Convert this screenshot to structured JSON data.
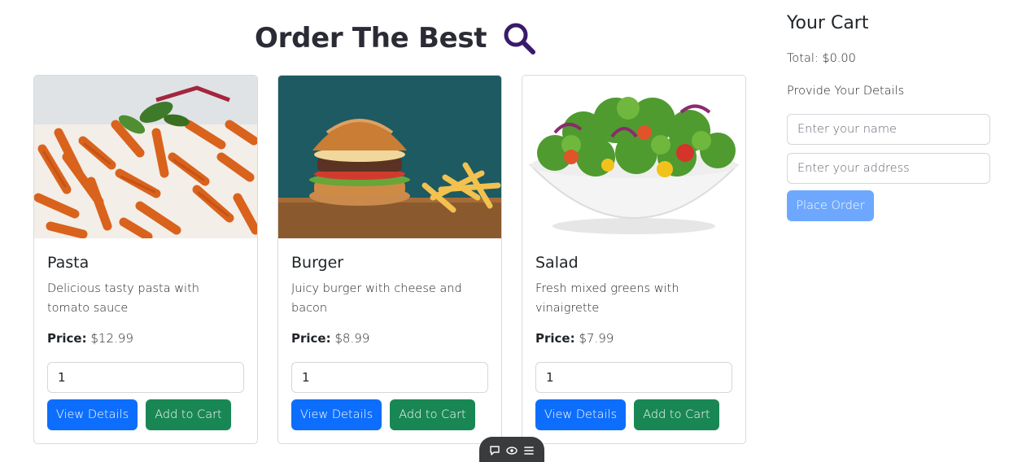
{
  "header": {
    "title": "Order The Best",
    "search_icon": "search-icon"
  },
  "products": [
    {
      "name": "Pasta",
      "description": "Delicious tasty pasta with tomato sauce",
      "price_label": "Price:",
      "price": "$12.99",
      "quantity": "1",
      "details_label": "View Details",
      "cart_label": "Add to Cart"
    },
    {
      "name": "Burger",
      "description": "Juicy burger with cheese and bacon",
      "price_label": "Price:",
      "price": "$8.99",
      "quantity": "1",
      "details_label": "View Details",
      "cart_label": "Add to Cart"
    },
    {
      "name": "Salad",
      "description": "Fresh mixed greens with vinaigrette",
      "price_label": "Price:",
      "price": "$7.99",
      "quantity": "1",
      "details_label": "View Details",
      "cart_label": "Add to Cart"
    }
  ],
  "cart": {
    "title": "Your Cart",
    "total": "Total: $0.00",
    "details_label": "Provide Your Details",
    "name_placeholder": "Enter your name",
    "address_placeholder": "Enter your address",
    "place_order_label": "Place Order"
  },
  "toolbar": {
    "icons": [
      "comment-icon",
      "eye-icon",
      "menu-icon"
    ]
  },
  "colors": {
    "primary": "#0d6efd",
    "success": "#198754",
    "disabled_primary": "#6ea8fe",
    "search_icon": "#3a1a6b"
  }
}
